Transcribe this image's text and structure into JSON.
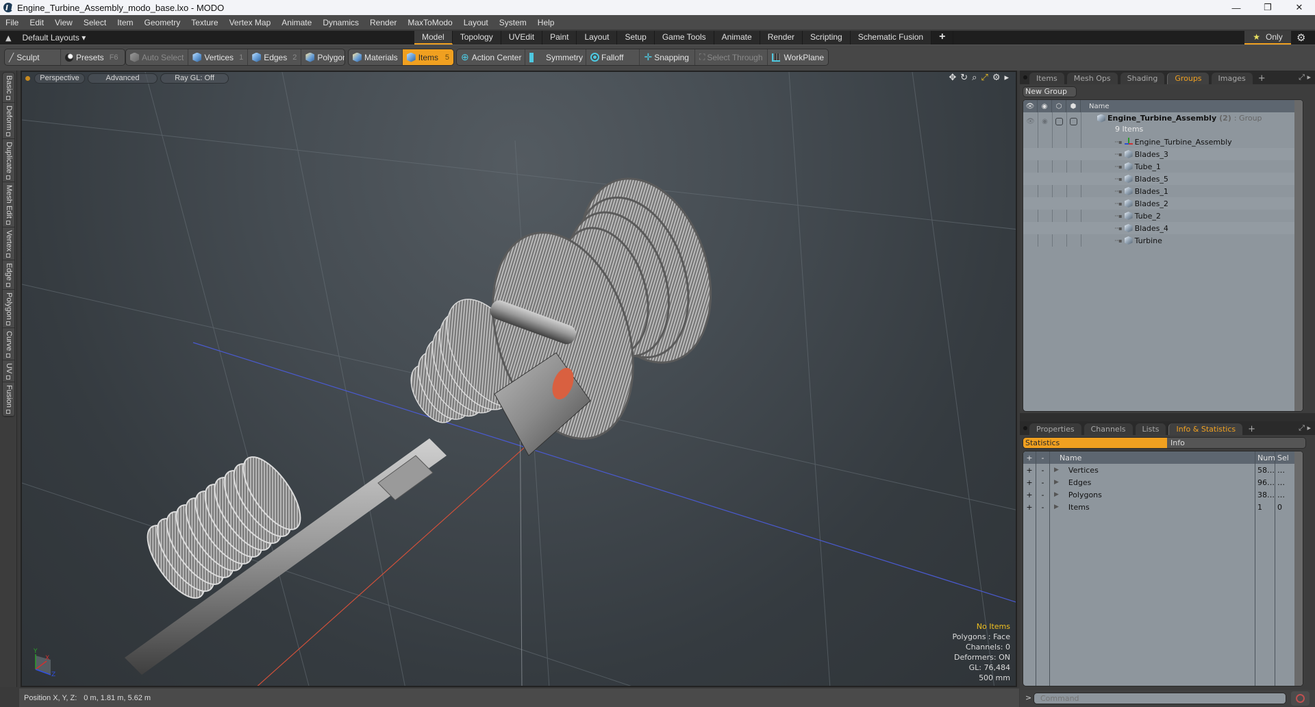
{
  "window": {
    "title": "Engine_Turbine_Assembly_modo_base.lxo - MODO",
    "controls": {
      "minimize": "—",
      "maximize": "❐",
      "close": "✕"
    }
  },
  "menu": [
    "File",
    "Edit",
    "View",
    "Select",
    "Item",
    "Geometry",
    "Texture",
    "Vertex Map",
    "Animate",
    "Dynamics",
    "Render",
    "MaxToModo",
    "Layout",
    "System",
    "Help"
  ],
  "layout_bar": {
    "layout_name": "Default Layouts ▾",
    "tabs": [
      "Model",
      "Topology",
      "UVEdit",
      "Paint",
      "Layout",
      "Setup",
      "Game Tools",
      "Animate",
      "Render",
      "Scripting",
      "Schematic Fusion"
    ],
    "active_tab": "Model",
    "add_tab": "+",
    "only_label": "Only"
  },
  "toolbar": {
    "sculpt": "Sculpt",
    "presets": "Presets",
    "presets_key": "F6",
    "auto_select": "Auto Select",
    "vertices": "Vertices",
    "vertices_key": "1",
    "edges": "Edges",
    "edges_key": "2",
    "polygons": "Polygons",
    "materials": "Materials",
    "items": "Items",
    "items_key": "5",
    "action_center": "Action Center",
    "symmetry": "Symmetry",
    "falloff": "Falloff",
    "snapping": "Snapping",
    "select_through": "Select Through",
    "workplane": "WorkPlane"
  },
  "left_tabs": [
    "Basic",
    "Deform",
    "Duplicate",
    "Mesh Edit",
    "Vertex",
    "Edge",
    "Polygon",
    "Curve",
    "UV",
    "Fusion"
  ],
  "viewport": {
    "view_mode": "Perspective",
    "shading": "Advanced",
    "raygl": "Ray GL: Off",
    "info": {
      "selection": "No Items",
      "polygons": "Polygons : Face",
      "channels": "Channels: 0",
      "deformers": "Deformers: ON",
      "gl": "GL: 76,484",
      "scale": "500 mm"
    },
    "gizmo": {
      "x": "X",
      "y": "Y",
      "z": "Z"
    }
  },
  "status_bar": {
    "label": "Position X, Y, Z:",
    "value": "0 m, 1.81 m, 5.62 m"
  },
  "groups_panel": {
    "tabs": [
      "Items",
      "Mesh Ops",
      "Shading",
      "Groups",
      "Images"
    ],
    "active_tab": "Groups",
    "new_group": "New Group",
    "column_name": "Name",
    "root": {
      "name": "Engine_Turbine_Assembly",
      "count": "(2)",
      "type": ": Group",
      "sub": "9 Items"
    },
    "items": [
      {
        "name": "Engine_Turbine_Assembly",
        "icon": "locator-icon"
      },
      {
        "name": "Blades_3",
        "icon": "mesh-icon"
      },
      {
        "name": "Tube_1",
        "icon": "mesh-icon"
      },
      {
        "name": "Blades_5",
        "icon": "mesh-icon"
      },
      {
        "name": "Blades_1",
        "icon": "mesh-icon"
      },
      {
        "name": "Blades_2",
        "icon": "mesh-icon"
      },
      {
        "name": "Tube_2",
        "icon": "mesh-icon"
      },
      {
        "name": "Blades_4",
        "icon": "mesh-icon"
      },
      {
        "name": "Turbine",
        "icon": "mesh-icon"
      }
    ]
  },
  "stats_panel": {
    "tabs": [
      "Properties",
      "Channels",
      "Lists",
      "Info & Statistics"
    ],
    "active_tab": "Info & Statistics",
    "toggle": [
      "Statistics",
      "Info"
    ],
    "columns": {
      "plus": "+",
      "minus": "-",
      "name": "Name",
      "num": "Num",
      "sel": "Sel"
    },
    "rows": [
      {
        "name": "Vertices",
        "num": "58…",
        "sel": "…"
      },
      {
        "name": "Edges",
        "num": "96…",
        "sel": "…"
      },
      {
        "name": "Polygons",
        "num": "38…",
        "sel": "…"
      },
      {
        "name": "Items",
        "num": "1",
        "sel": "0"
      }
    ]
  },
  "command": {
    "prompt": ">",
    "placeholder": "Command"
  },
  "colors": {
    "accent": "#f0a020",
    "viewport_bg": "#3a4045",
    "panel_list_bg": "#8e969d",
    "header_bg": "#5d6670"
  }
}
